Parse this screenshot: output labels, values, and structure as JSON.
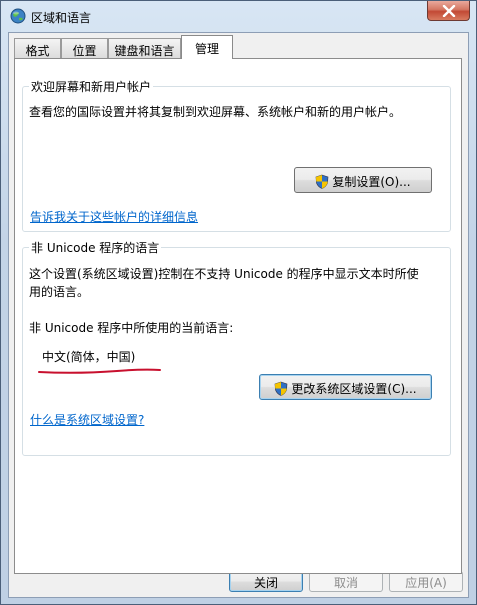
{
  "window": {
    "title": "区域和语言",
    "close_glyph": "✕"
  },
  "tabs": [
    {
      "label": "格式",
      "active": false
    },
    {
      "label": "位置",
      "active": false
    },
    {
      "label": "键盘和语言",
      "active": false
    },
    {
      "label": "管理",
      "active": true
    }
  ],
  "welcome_group": {
    "title": "欢迎屏幕和新用户帐户",
    "description": "查看您的国际设置并将其复制到欢迎屏幕、系统帐户和新的用户帐户。",
    "copy_button": "复制设置(O)...",
    "link": "告诉我关于这些帐户的详细信息"
  },
  "unicode_group": {
    "title": "非 Unicode 程序的语言",
    "description_line1": "这个设置(系统区域设置)控制在不支持 Unicode 的程序中显示文本时所使",
    "description_line2": "用的语言。",
    "current_label": "非 Unicode 程序中所使用的当前语言:",
    "current_value": "中文(简体，中国)",
    "change_button": "更改系统区域设置(C)...",
    "link": "什么是系统区域设置?"
  },
  "dialog_buttons": {
    "close": "关闭",
    "cancel": "取消",
    "apply": "应用(A)"
  },
  "colors": {
    "annotation_underline": "#c8102e",
    "link": "#0066cc"
  }
}
